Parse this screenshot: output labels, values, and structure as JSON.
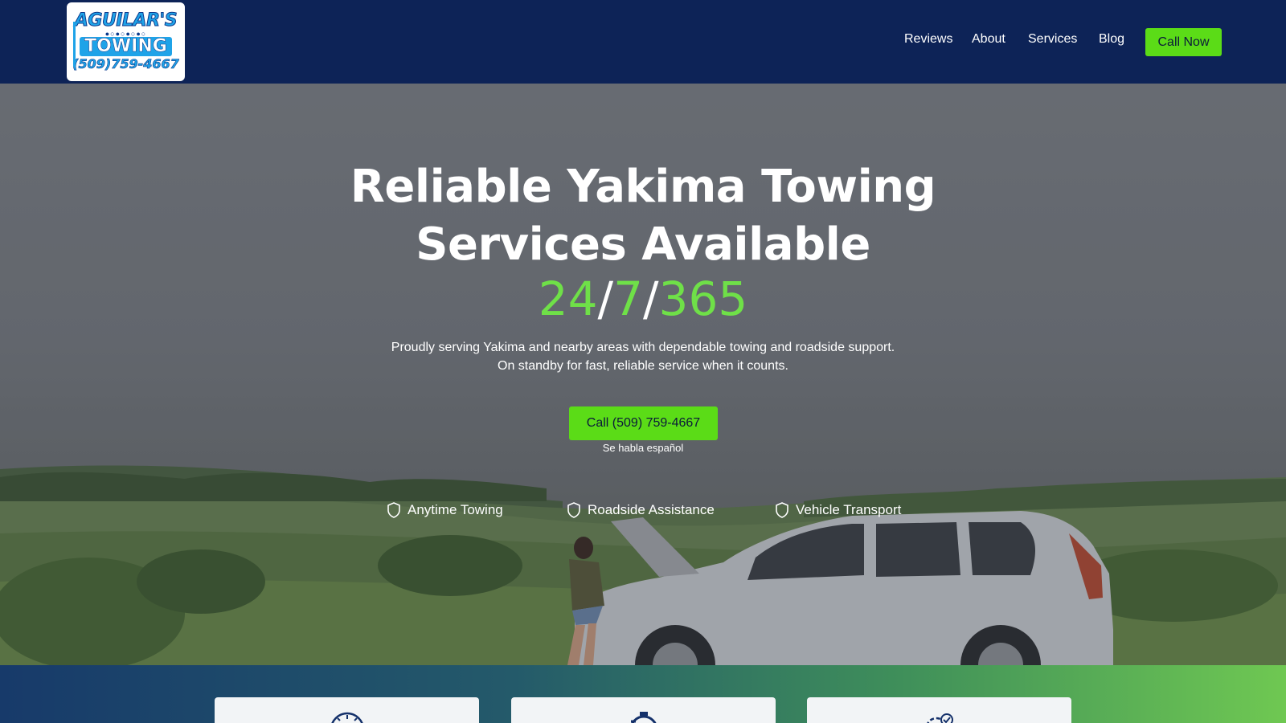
{
  "header": {
    "logo": {
      "line1": "AGUILAR'S",
      "line2": "TOWING",
      "line3": "(509)759-4667"
    },
    "nav": [
      {
        "label": "Reviews"
      },
      {
        "label": "About"
      },
      {
        "label": "Services"
      },
      {
        "label": "Blog"
      }
    ],
    "cta_label": "Call Now",
    "cta_color": "#5bdc17",
    "background": "#0d2357"
  },
  "hero": {
    "title_line1": "Reliable Yakima Towing",
    "title_line2": "Services Available",
    "availability": {
      "a": "24",
      "sep1": "/",
      "b": "7",
      "sep2": "/",
      "c": "365"
    },
    "accent_color": "#6fe048",
    "subtitle": "Proudly serving Yakima and nearby areas with dependable towing and roadside support. On standby for fast, reliable service when it counts.",
    "cta_label": "Call (509) 759-4667",
    "spanish_note": "Se habla español",
    "features": [
      {
        "label": "Anytime Towing",
        "icon": "shield-icon"
      },
      {
        "label": "Roadside Assistance",
        "icon": "shield-icon"
      },
      {
        "label": "Vehicle Transport",
        "icon": "shield-icon"
      }
    ]
  },
  "cards": [
    {
      "icon": "stopwatch-icon"
    },
    {
      "icon": "timer-icon"
    },
    {
      "icon": "gear-check-icon"
    }
  ]
}
